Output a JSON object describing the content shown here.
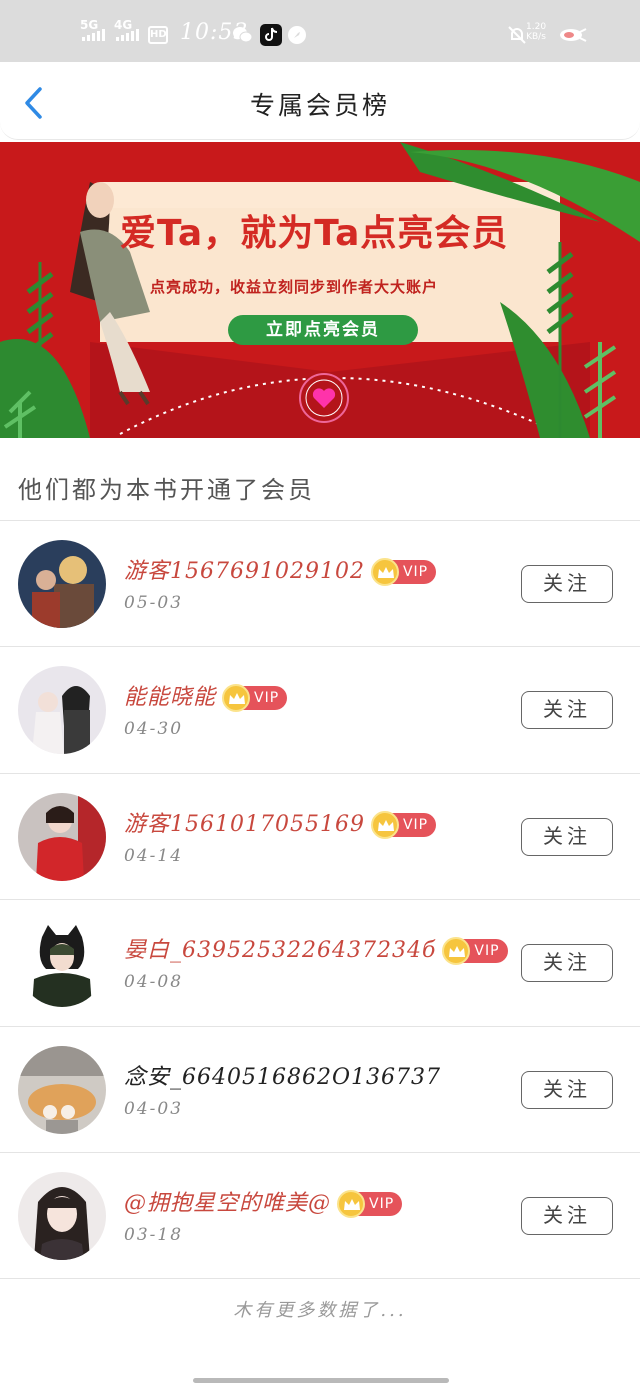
{
  "status_bar": {
    "signal_1": "5G",
    "signal_2": "4G",
    "hd_badge": "HD",
    "time": "10:53",
    "net_speed_value": "1.20",
    "net_speed_unit": "KB/s"
  },
  "nav": {
    "title": "专属会员榜"
  },
  "banner": {
    "headline": "爱Ta，就为Ta点亮会员",
    "subtitle": "点亮成功，收益立刻同步到作者大大账户",
    "cta": "立即点亮会员"
  },
  "section_title": "他们都为本书开通了会员",
  "vip_label": "VIP",
  "follow_label": "关注",
  "members": [
    {
      "name": "游客1567691029102",
      "date": "05-03",
      "vip": true
    },
    {
      "name": "能能晓能",
      "date": "04-30",
      "vip": true
    },
    {
      "name": "游客1561017055169",
      "date": "04-14",
      "vip": true
    },
    {
      "name": "晏白_6395253226437234б",
      "date": "04-08",
      "vip": true
    },
    {
      "name": "念安_6640516862O136737",
      "date": "04-03",
      "vip": false
    },
    {
      "name": "@拥抱星空的唯美@",
      "date": "03-18",
      "vip": true
    }
  ],
  "footer": "木有更多数据了...",
  "colors": {
    "accent_blue": "#2f8ae5",
    "banner_red": "#c8191b",
    "vip_red": "#e5535a",
    "vip_name": "#c8483e",
    "cta_green": "#2e9a43"
  }
}
